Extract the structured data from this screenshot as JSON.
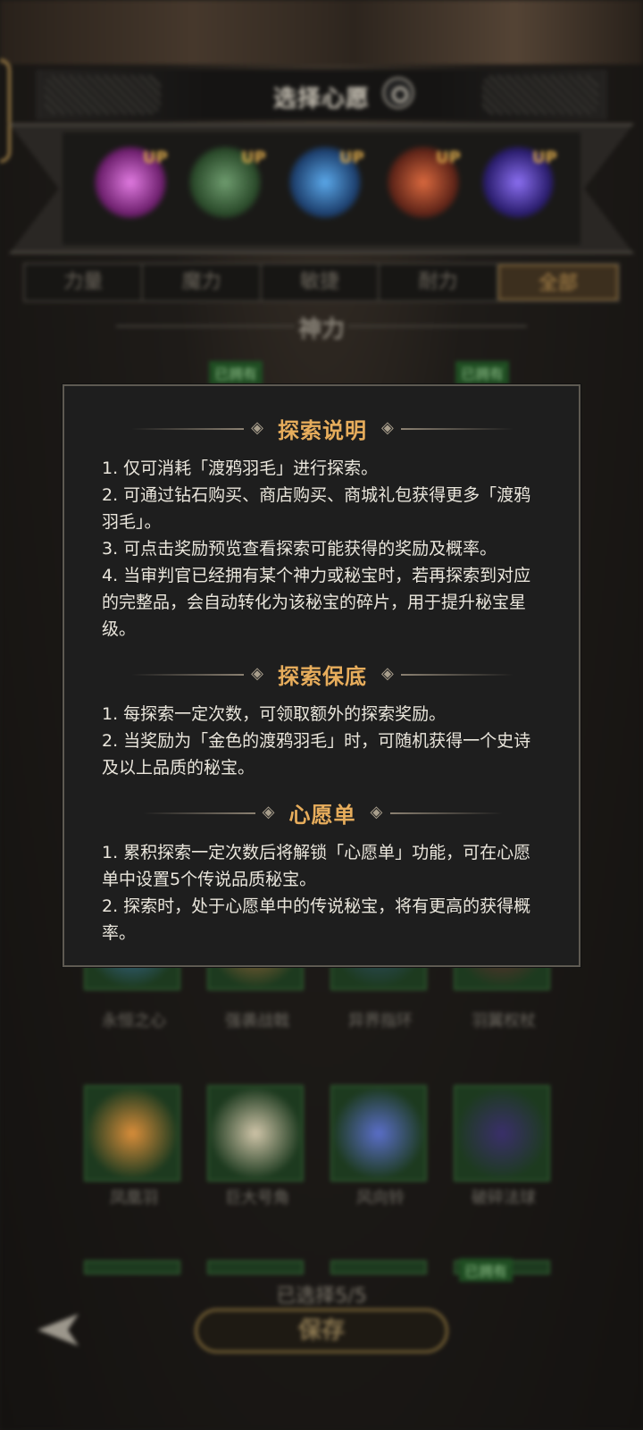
{
  "background": {
    "title": "选择心愿",
    "wish_slots": [
      {
        "up_label": "UP",
        "color": "#b03fb0"
      },
      {
        "up_label": "UP",
        "color": "#3c6b3c"
      },
      {
        "up_label": "UP",
        "color": "#2d5e9e"
      },
      {
        "up_label": "UP",
        "color": "#9e3a2a"
      },
      {
        "up_label": "UP",
        "color": "#5b3fb0"
      }
    ],
    "attribute_tabs": [
      "力量",
      "魔力",
      "敏捷",
      "耐力",
      "全部"
    ],
    "active_tab": "全部",
    "section_title": "神力",
    "owned_label": "已拥有",
    "row1_labels": [
      "永恒之心",
      "强袭战戟",
      "异界指环",
      "羽翼权杖"
    ],
    "row2_labels": [
      "凤凰羽",
      "巨大号角",
      "风向铃",
      "破碎法球"
    ],
    "selected_count": "已选择5/5",
    "save_label": "保存"
  },
  "modal": {
    "sections": [
      {
        "title": "探索说明",
        "items": [
          "1. 仅可消耗「渡鸦羽毛」进行探索。",
          "2. 可通过钻石购买、商店购买、商城礼包获得更多「渡鸦羽毛」。",
          "3. 可点击奖励预览查看探索可能获得的奖励及概率。",
          "4. 当审判官已经拥有某个神力或秘宝时，若再探索到对应的完整品，会自动转化为该秘宝的碎片，用于提升秘宝星级。"
        ]
      },
      {
        "title": "探索保底",
        "items": [
          "1. 每探索一定次数，可领取额外的探索奖励。",
          "2. 当奖励为「金色的渡鸦羽毛」时，可随机获得一个史诗及以上品质的秘宝。"
        ]
      },
      {
        "title": "心愿单",
        "items": [
          "1. 累积探索一定次数后将解锁「心愿单」功能，可在心愿单中设置5个传说品质秘宝。",
          "2. 探索时，处于心愿单中的传说秘宝，将有更高的获得概率。"
        ]
      }
    ]
  }
}
